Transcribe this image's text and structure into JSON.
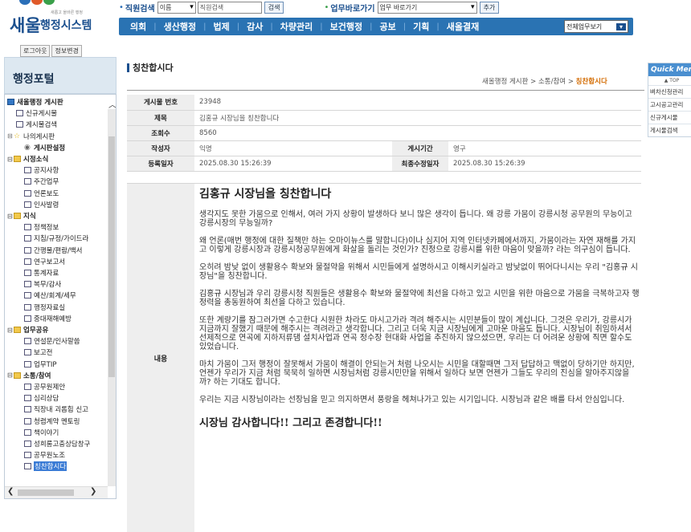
{
  "logo": {
    "main": "새울",
    "sub": "행정시스템",
    "tagline": "새롭고 올바른 행정"
  },
  "search": {
    "label": "직원검색",
    "field_value": "이름",
    "input_value": "직원검색",
    "button": "검색"
  },
  "quickgo": {
    "label": "업무바로가기",
    "value": "업무 바로가기",
    "button": "추가"
  },
  "nav": {
    "items": [
      "의회",
      "생산행정",
      "법제",
      "감사",
      "차량관리",
      "보건행정",
      "공보",
      "기획",
      "새올결재"
    ],
    "select": "전체업무보기"
  },
  "auth": {
    "logout": "로그아웃",
    "info": "정보변경"
  },
  "portal_title": "행정포털",
  "tree": [
    {
      "label": "새올행정 게시판",
      "icon": "root",
      "pm": "",
      "bold": true
    },
    {
      "label": "신규게시물",
      "icon": "page",
      "pm": "",
      "ind": 1
    },
    {
      "label": "게시물검색",
      "icon": "page",
      "pm": "",
      "ind": 1
    },
    {
      "label": "나의게시판",
      "icon": "star",
      "pm": "⊟",
      "ind": 0
    },
    {
      "label": "게시판설정",
      "icon": "gear",
      "pm": "",
      "ind": 2,
      "bold": true
    },
    {
      "label": "시정소식",
      "icon": "fold",
      "pm": "⊟",
      "ind": 0,
      "bold": true
    },
    {
      "label": "공지사항",
      "icon": "page",
      "pm": "",
      "ind": 2
    },
    {
      "label": "주간업무",
      "icon": "page",
      "pm": "",
      "ind": 2
    },
    {
      "label": "언론보도",
      "icon": "page",
      "pm": "",
      "ind": 2
    },
    {
      "label": "인사발령",
      "icon": "page",
      "pm": "",
      "ind": 2
    },
    {
      "label": "지식",
      "icon": "fold",
      "pm": "⊟",
      "ind": 0,
      "bold": true
    },
    {
      "label": "정책정보",
      "icon": "page",
      "pm": "",
      "ind": 2
    },
    {
      "label": "지침/규정/가이드라",
      "icon": "page",
      "pm": "",
      "ind": 2
    },
    {
      "label": "간행물/편람/백서",
      "icon": "page",
      "pm": "",
      "ind": 2
    },
    {
      "label": "연구보고서",
      "icon": "page",
      "pm": "",
      "ind": 2
    },
    {
      "label": "통계자료",
      "icon": "page",
      "pm": "",
      "ind": 2
    },
    {
      "label": "복무/감사",
      "icon": "page",
      "pm": "",
      "ind": 2
    },
    {
      "label": "예산/회계/세무",
      "icon": "page",
      "pm": "",
      "ind": 2
    },
    {
      "label": "행정자료실",
      "icon": "page",
      "pm": "",
      "ind": 2
    },
    {
      "label": "중대재해예방",
      "icon": "page",
      "pm": "",
      "ind": 2
    },
    {
      "label": "업무공유",
      "icon": "fold",
      "pm": "⊟",
      "ind": 0,
      "bold": true
    },
    {
      "label": "연설문/인사말씀",
      "icon": "page",
      "pm": "",
      "ind": 2
    },
    {
      "label": "보고전",
      "icon": "page",
      "pm": "",
      "ind": 2
    },
    {
      "label": "업무TIP",
      "icon": "page",
      "pm": "",
      "ind": 2
    },
    {
      "label": "소통/참여",
      "icon": "fold",
      "pm": "⊟",
      "ind": 0,
      "bold": true
    },
    {
      "label": "공무원제안",
      "icon": "page",
      "pm": "",
      "ind": 2
    },
    {
      "label": "심리상담",
      "icon": "page",
      "pm": "",
      "ind": 2
    },
    {
      "label": "직장내 괴롭힘 신고",
      "icon": "page",
      "pm": "",
      "ind": 2
    },
    {
      "label": "청렴계약 멘토링",
      "icon": "page",
      "pm": "",
      "ind": 2
    },
    {
      "label": "책이야기",
      "icon": "page",
      "pm": "",
      "ind": 2
    },
    {
      "label": "성희롱고충상담창구",
      "icon": "page",
      "pm": "",
      "ind": 2
    },
    {
      "label": "공무원노조",
      "icon": "page",
      "pm": "",
      "ind": 2
    },
    {
      "label": "칭찬합시다",
      "icon": "page",
      "pm": "",
      "ind": 2,
      "hl": true
    }
  ],
  "page_title": "칭찬합시다",
  "breadcrumb": {
    "a": "새올행정 게시판",
    "b": "소통/참여",
    "c": "칭찬합시다",
    "sep": ">"
  },
  "meta": {
    "no_label": "게시물 번호",
    "no": "23948",
    "subject_label": "제목",
    "subject": "김홍규 시장님을 칭찬합니다",
    "views_label": "조회수",
    "views": "8560",
    "author_label": "작성자",
    "author": "익명",
    "period_label": "게시기간",
    "period": "영구",
    "reg_label": "등록일자",
    "reg": "2025.08.30 15:26:39",
    "mod_label": "최종수정일자",
    "mod": "2025.08.30 15:26:39"
  },
  "body": {
    "label": "내용",
    "title": "김홍규 시장님을 칭찬합니다",
    "paragraphs": [
      "생각지도 못한 가뭄으로 인해서, 여러 가지 상황이 발생하다 보니 많은 생각이 듭니다. 왜 강릉 가뭄이 강릉시청 공무원의 무능이고 강릉시장의 무능일까?",
      "왜 언론(매번 행정에 대한 질책만 하는 오마이뉴스를 말합니다)이나 심지어 지역 인터넷카페에서까지, 가뭄이라는 자연 재해를 가지고 이렇게 강릉시장과 강릉시청공무원에게 화살을 돌리는 것인가? 진정으로 강릉시를 위한 마음이 맞을까? 라는 의구심이 듭니다.",
      " 오히려 밤낮 없이 생활용수 확보와 물절약을 위해서 시민들에게 설명하시고 이해시키실라고  밤낮없이 뛰어다니시는 우리 \"김홍규 시장님\"을 칭찬합니다.",
      "김홍규 시장님과 우리 강릉시청 직원들은 생활용수 확보와 물절약에 최선을 다하고 있고 시민을 위한 마음으로 가뭄을 극복하고자 행정력을 총동원하여 최선을 다하고 있습니다.",
      "또한 계량기를 잠그러가면 수고한다 시원한 차라도 마시고가라 격려 해주시는 시민분들이 많이 계십니다. 그것은 우리가, 강릉시가 지금까지 잘했기 때문에 해주시는 격려라고 생각합니다. 그리고 더욱 지금 시장님에게 고마운 마음도 듭니다. 시장님이 취임하셔서 선제적으로 연곡에 지하저류댐 설치사업과 연곡 정수장 현대화 사업을 추진하지 않으셨으면, 우리는 더 어려운 상황에 직면 할수도 있었습니다.",
      "마치 가뭄이 그저 행정이 잘못해서 가뭄이 해결이 안되는거 처럼 나오시는 시민을 대할때면 그저 답답하고 맥없이 당하기만 하지만, 언젠가 우리가 지금 처럼 묵묵히 일하면 시장님처럼 강릉시민만을 위해서 일하다 보면 언젠가 그들도 우리의 진심을 알아주지않을까? 하는 기대도 합니다.",
      "우리는 지금 시장님이라는 선장님을 믿고 의지하면서 풍랑을 헤쳐나가고 있는 시기입니다. 시장님과 같은 배를 타서 안심입니다."
    ],
    "closing": "시장님 감사합니다!! 그리고 존경합니다!!"
  },
  "quick": {
    "title": "Quick Menu",
    "top": "▲ TOP",
    "items": [
      "벼차신청관리",
      "고시공고관리",
      "신규게시물",
      "게시물검색"
    ]
  }
}
